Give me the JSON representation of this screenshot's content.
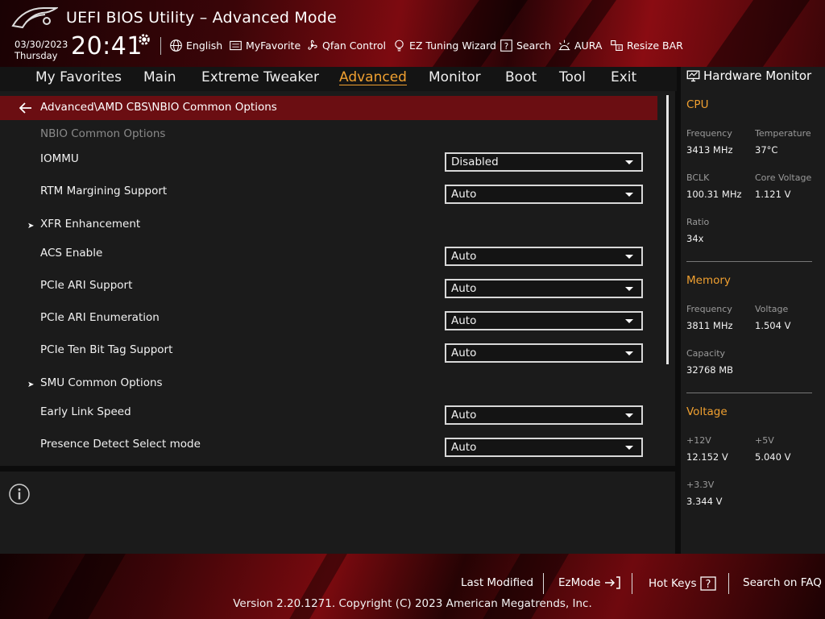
{
  "header": {
    "title": "UEFI BIOS Utility – Advanced Mode",
    "date": "03/30/2023",
    "day": "Thursday",
    "time": "20:41",
    "tools": {
      "language": "English",
      "myfavorite": "MyFavorite",
      "qfan": "Qfan Control",
      "ez_tuning": "EZ Tuning Wizard",
      "search": "Search",
      "aura": "AURA",
      "resize_bar": "Resize BAR"
    }
  },
  "nav": {
    "tabs": [
      "My Favorites",
      "Main",
      "Extreme Tweaker",
      "Advanced",
      "Monitor",
      "Boot",
      "Tool",
      "Exit"
    ],
    "active": "Advanced"
  },
  "main": {
    "breadcrumb": "Advanced\\AMD CBS\\NBIO Common Options",
    "section_title": "NBIO Common Options",
    "items": [
      {
        "label": "IOMMU",
        "value": "Disabled"
      },
      {
        "label": "RTM Margining Support",
        "value": "Auto"
      },
      {
        "label": "XFR Enhancement",
        "submenu": true
      },
      {
        "label": "ACS Enable",
        "value": "Auto"
      },
      {
        "label": "PCIe ARI Support",
        "value": "Auto"
      },
      {
        "label": "PCIe ARI Enumeration",
        "value": "Auto"
      },
      {
        "label": "PCIe Ten Bit Tag Support",
        "value": "Auto"
      },
      {
        "label": "SMU Common Options",
        "submenu": true
      },
      {
        "label": "Early Link Speed",
        "value": "Auto"
      },
      {
        "label": "Presence Detect Select mode",
        "value": "Auto"
      }
    ]
  },
  "hw_monitor": {
    "title": "Hardware Monitor",
    "cpu": {
      "heading": "CPU",
      "frequency_label": "Frequency",
      "frequency": "3413 MHz",
      "temperature_label": "Temperature",
      "temperature": "37°C",
      "bclk_label": "BCLK",
      "bclk": "100.31 MHz",
      "core_voltage_label": "Core Voltage",
      "core_voltage": "1.121 V",
      "ratio_label": "Ratio",
      "ratio": "34x"
    },
    "memory": {
      "heading": "Memory",
      "frequency_label": "Frequency",
      "frequency": "3811 MHz",
      "voltage_label": "Voltage",
      "voltage": "1.504 V",
      "capacity_label": "Capacity",
      "capacity": "32768 MB"
    },
    "voltage": {
      "heading": "Voltage",
      "v12_label": "+12V",
      "v12": "12.152 V",
      "v5_label": "+5V",
      "v5": "5.040 V",
      "v33_label": "+3.3V",
      "v33": "3.344 V"
    }
  },
  "footer": {
    "last_modified": "Last Modified",
    "ezmode": "EzMode",
    "hot_keys": "Hot Keys",
    "search_faq": "Search on FAQ",
    "copyright": "Version 2.20.1271. Copyright (C) 2023 American Megatrends, Inc."
  },
  "colors": {
    "accent": "#f0a030",
    "breadcrumb_bg": "#6b0e12",
    "panel_bg": "#1b1b1b"
  }
}
